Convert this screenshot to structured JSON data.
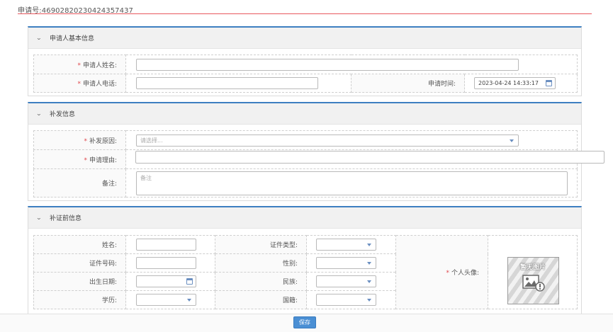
{
  "header": {
    "application_number": "申请号:46902820230424357437"
  },
  "section_basic": {
    "title": "申请人基本信息",
    "name_label": "申请人姓名:",
    "phone_label": "申请人电话:",
    "time_label": "申请时间:",
    "time_value": "2023-04-24 14:33:17"
  },
  "section_reissue": {
    "title": "补发信息",
    "reason_label": "补发原因:",
    "reason_placeholder": "请选择...",
    "justification_label": "申请理由:",
    "remarks_label": "备注:",
    "remarks_placeholder": "备注"
  },
  "section_previous": {
    "title": "补证前信息",
    "name_label": "姓名:",
    "id_type_label": "证件类型:",
    "id_number_label": "证件号码:",
    "gender_label": "性别:",
    "birth_label": "出生日期:",
    "ethnicity_label": "民族:",
    "education_label": "学历:",
    "nationality_label": "国籍:",
    "avatar_label": "个人头像:",
    "no_photo_text": "暂无图片"
  },
  "footer": {
    "save_label": "保存"
  },
  "colors": {
    "accent": "#3d7fc1",
    "required": "#e0474c",
    "divider": "#e8585e",
    "button": "#4a8fd4"
  }
}
